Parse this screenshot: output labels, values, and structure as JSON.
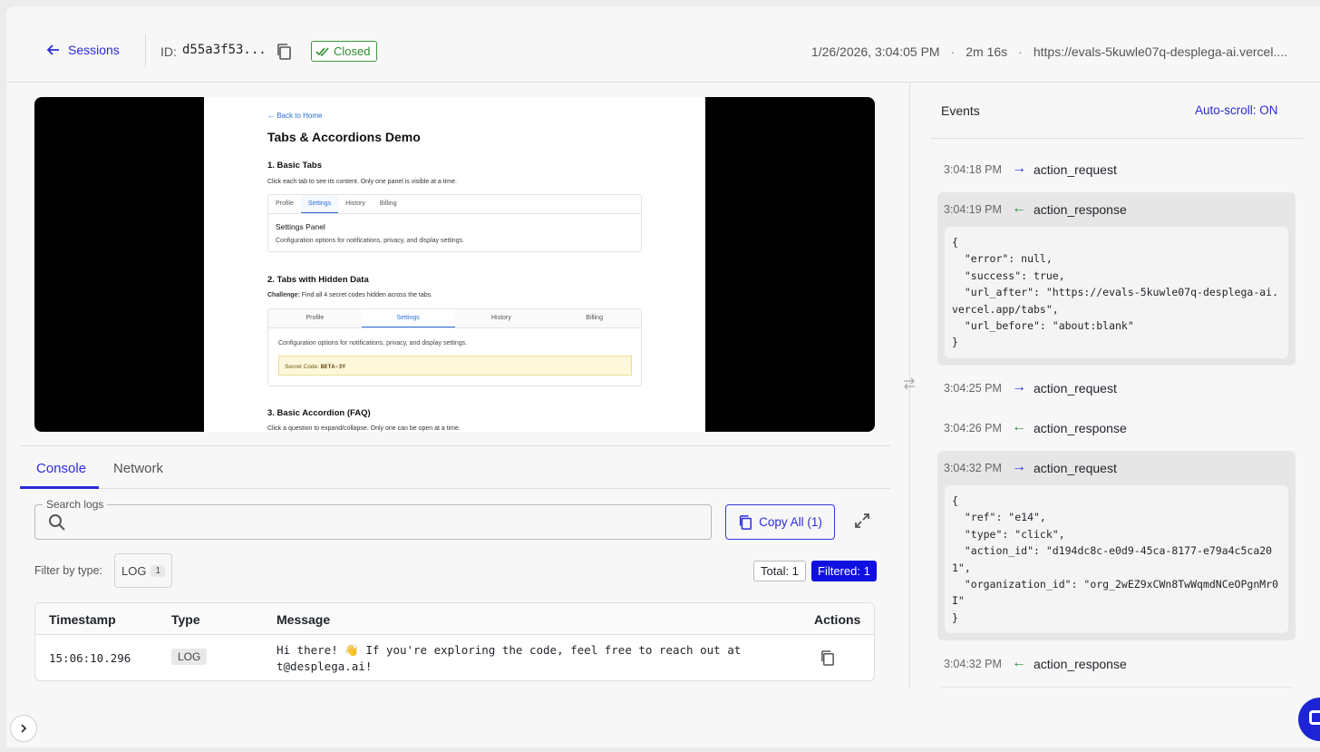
{
  "header": {
    "back_label": "Sessions",
    "id_label": "ID:",
    "id_value": "d55a3f53...",
    "status": "Closed",
    "datetime": "1/26/2026, 3:04:05 PM",
    "duration": "2m 16s",
    "url": "https://evals-5kuwle07q-desplega-ai.vercel...."
  },
  "screenshot": {
    "back_link": "← Back to Home",
    "title": "Tabs & Accordions Demo",
    "section1_title": "1. Basic Tabs",
    "section1_desc": "Click each tab to see its content. Only one panel is visible at a time.",
    "tabs1": [
      "Profile",
      "Settings",
      "History",
      "Billing"
    ],
    "panel_title": "Settings Panel",
    "panel_desc": "Configuration options for notifications, privacy, and display settings.",
    "section2_title": "2. Tabs with Hidden Data",
    "challenge_label": "Challenge:",
    "challenge_text": "Find all 4 secret codes hidden across the tabs.",
    "tabs2": [
      "Profile",
      "Settings",
      "History",
      "Billing"
    ],
    "panel2_desc": "Configuration options for notifications, privacy, and display settings.",
    "secret_label": "Secret Code:",
    "secret_value": "BETA-3Y",
    "section3_title": "3. Basic Accordion (FAQ)",
    "section3_desc": "Click a question to expand/collapse. Only one can be open at a time."
  },
  "bottom_tabs": [
    "Console",
    "Network"
  ],
  "console": {
    "search_label": "Search logs",
    "search_placeholder": "",
    "copy_all_label": "Copy All (1)",
    "filter_label": "Filter by type:",
    "log_chip_label": "LOG",
    "log_chip_count": "1",
    "total_label": "Total: 1",
    "filtered_label": "Filtered: 1",
    "columns": [
      "Timestamp",
      "Type",
      "Message",
      "Actions"
    ],
    "rows": [
      {
        "timestamp": "15:06:10.296",
        "type": "LOG",
        "message_line1": "Hi there! 👋 If you're exploring the code, feel free to reach out at",
        "message_line2": "t@desplega.ai!"
      }
    ]
  },
  "events_panel": {
    "title": "Events",
    "autoscroll_label": "Auto-scroll: ON",
    "events": [
      {
        "time": "3:04:18 PM",
        "direction": "→",
        "name": "action_request",
        "body": ""
      },
      {
        "time": "3:04:19 PM",
        "direction": "←",
        "name": "action_response",
        "body": "{\n  \"error\": null,\n  \"success\": true,\n  \"url_after\": \"https://evals-5kuwle07q-desplega-ai.\nvercel.app/tabs\",\n  \"url_before\": \"about:blank\"\n}"
      },
      {
        "time": "3:04:25 PM",
        "direction": "→",
        "name": "action_request",
        "body": ""
      },
      {
        "time": "3:04:26 PM",
        "direction": "←",
        "name": "action_response",
        "body": ""
      },
      {
        "time": "3:04:32 PM",
        "direction": "→",
        "name": "action_request",
        "body": "{\n  \"ref\": \"e14\",\n  \"type\": \"click\",\n  \"action_id\": \"d194dc8c-e0d9-45ca-8177-e79a4c5ca20\n1\",\n  \"organization_id\": \"org_2wEZ9xCWn8TwWqmdNCeOPgnMr0\nI\"\n}"
      },
      {
        "time": "3:04:32 PM",
        "direction": "←",
        "name": "action_response",
        "body": ""
      }
    ]
  }
}
